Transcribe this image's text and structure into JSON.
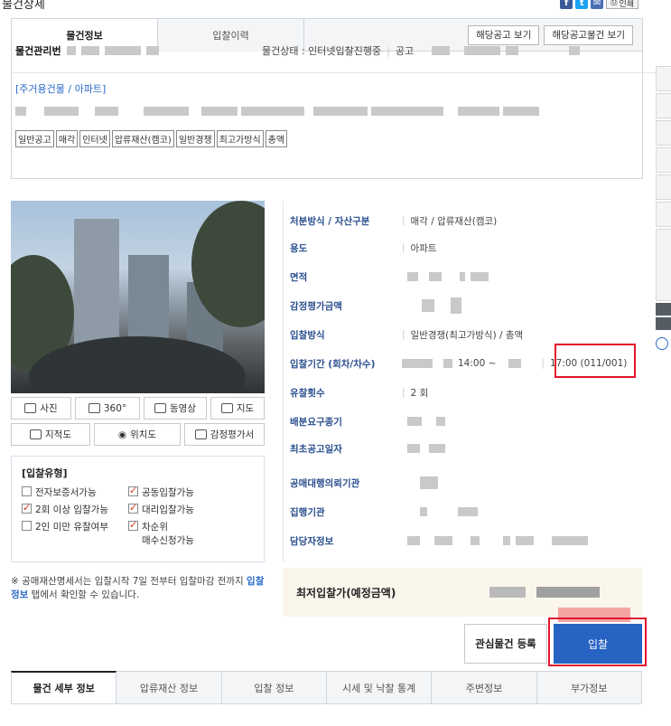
{
  "header": {
    "page_title": "물건상세",
    "print_label": "인쇄"
  },
  "tabs": {
    "item_info": "물건정보",
    "bid_history": "입찰이력",
    "view_notice": "해당공고 보기",
    "view_notice_items": "해당공고물건 보기"
  },
  "item": {
    "mgmt_label": "물건관리번",
    "status_text": "물건상태 : 인터넷입찰진행중",
    "notice_label": "공고",
    "category": "[주거용건물 / 아파트]",
    "chips": [
      "일반공고",
      "매각",
      "인터넷",
      "압류재산(캠코)",
      "일반경쟁",
      "최고가방식",
      "총액"
    ]
  },
  "media_buttons": [
    "사진",
    "360°",
    "동영상",
    "지도",
    "지적도",
    "위치도",
    "감정평가서"
  ],
  "bid_type": {
    "title": "[입찰유형]",
    "options": [
      {
        "label": "전자보증서가능",
        "checked": false
      },
      {
        "label": "공동입찰가능",
        "checked": true
      },
      {
        "label": "2회 이상 입찰가능",
        "checked": true
      },
      {
        "label": "대리입찰가능",
        "checked": true
      },
      {
        "label": "2인 미만 유찰여부",
        "checked": false
      },
      {
        "label": "차순위\n매수신청가능",
        "checked": true
      }
    ]
  },
  "notice": {
    "text_before": "※ 공매재산명세서는 입찰시작 7일 전부터 입찰마감 전까지 ",
    "link": "입찰정보",
    "text_after": " 탭에서 확인할 수 있습니다."
  },
  "details": {
    "method_label": "처분방식 / 자산구분",
    "method_value": "매각 / 압류재산(캠코)",
    "usage_label": "용도",
    "usage_value": "아파트",
    "area_label": "면적",
    "appraisal_label": "감정평가금액",
    "bid_method_label": "입찰방식",
    "bid_method_value": "일반경쟁(최고가방식) / 총액",
    "period_label": "입찰기간 (회차/차수)",
    "period_start": "14:00 ~",
    "period_end": "17:00 (011/001)",
    "fail_count_label": "유찰횟수",
    "fail_count_value": "2 회",
    "dist_label": "배분요구종기",
    "first_notice_label": "최초공고일자",
    "agent_label": "공매대행의뢰기관",
    "exec_label": "집행기관",
    "contact_label": "담당자정보"
  },
  "price": {
    "label": "최저입찰가(예정금액)"
  },
  "actions": {
    "favorite": "관심물건 등록",
    "bid": "입찰"
  },
  "bottom_tabs": [
    "물건 세부 정보",
    "압류재산 정보",
    "입찰 정보",
    "시세 및 낙찰 통계",
    "주변정보",
    "부가정보"
  ]
}
